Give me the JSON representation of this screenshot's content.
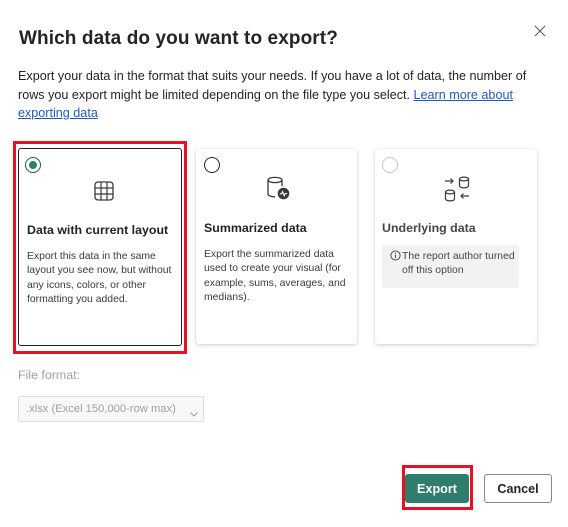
{
  "dialog": {
    "title": "Which data do you want to export?",
    "description_text": "Export your data in the format that suits your needs. If you have a lot of data, the number of rows you export might be limited depending on the file type you select.",
    "learn_more_link": "Learn more about exporting data"
  },
  "options": [
    {
      "title": "Data with current layout",
      "description": "Export this data in the same layout you see now, but without any icons, colors, or other formatting you added.",
      "selected": true,
      "icon": "table-grid-icon"
    },
    {
      "title": "Summarized data",
      "description": "Export the summarized data used to create your visual (for example, sums, averages, and medians).",
      "selected": false,
      "icon": "database-chart-icon"
    },
    {
      "title": "Underlying data",
      "info": "The report author turned off this option",
      "selected": false,
      "disabled": true,
      "icon": "database-exchange-icon"
    }
  ],
  "file_format": {
    "label": "File format:",
    "value": ".xlsx (Excel 150,000-row max)"
  },
  "buttons": {
    "export": "Export",
    "cancel": "Cancel"
  },
  "colors": {
    "accent": "#2f7d6d",
    "highlight": "#e81123",
    "link": "#1f5bb5"
  }
}
